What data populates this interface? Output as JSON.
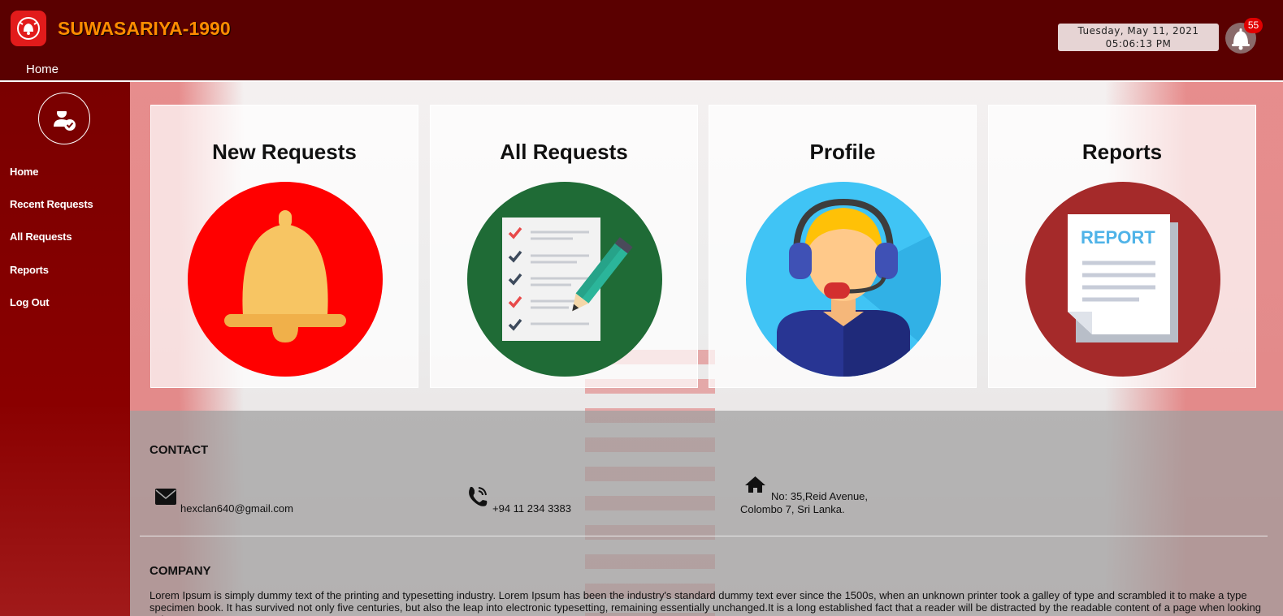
{
  "header": {
    "brand": "SUWASARIYA-1990",
    "nav_home": "Home",
    "date": "Tuesday, May 11, 2021",
    "time": "05:06:13 PM",
    "notification_count": "55"
  },
  "sidebar": {
    "items": [
      {
        "label": "Home"
      },
      {
        "label": "Recent Requests"
      },
      {
        "label": "All Requests"
      },
      {
        "label": "Reports"
      },
      {
        "label": "Log Out"
      }
    ]
  },
  "cards": [
    {
      "title": "New Requests",
      "icon": "bell-icon",
      "color": "#ff0000"
    },
    {
      "title": "All Requests",
      "icon": "checklist-icon",
      "color": "#1f6b36"
    },
    {
      "title": "Profile",
      "icon": "headset-agent-icon",
      "color": "#40c4f5"
    },
    {
      "title": "Reports",
      "icon": "report-document-icon",
      "color": "#a52a2a",
      "badge_text": "REPORT"
    }
  ],
  "footer": {
    "contact_heading": "CONTACT",
    "email": "hexclan640@gmail.com",
    "phone": "+94 11 234 3383",
    "address_line1": "No: 35,Reid Avenue,",
    "address_line2": "Colombo 7, Sri Lanka.",
    "company_heading": "COMPANY",
    "company_text": "Lorem Ipsum is simply dummy text of the printing and typesetting industry. Lorem Ipsum has been the industry's standard dummy text ever since the 1500s, when an unknown printer took a galley of type and scrambled it to make a type specimen book. It has survived not only five centuries, but also the leap into electronic typesetting, remaining essentially unchanged.It is a long established fact that a reader will be distracted by the readable content of a page when looking at its"
  },
  "colors": {
    "header_bg": "#5a0000",
    "brand_text": "#ff8c00",
    "sidebar_bg": "#7a0000",
    "badge": "#e00000"
  }
}
